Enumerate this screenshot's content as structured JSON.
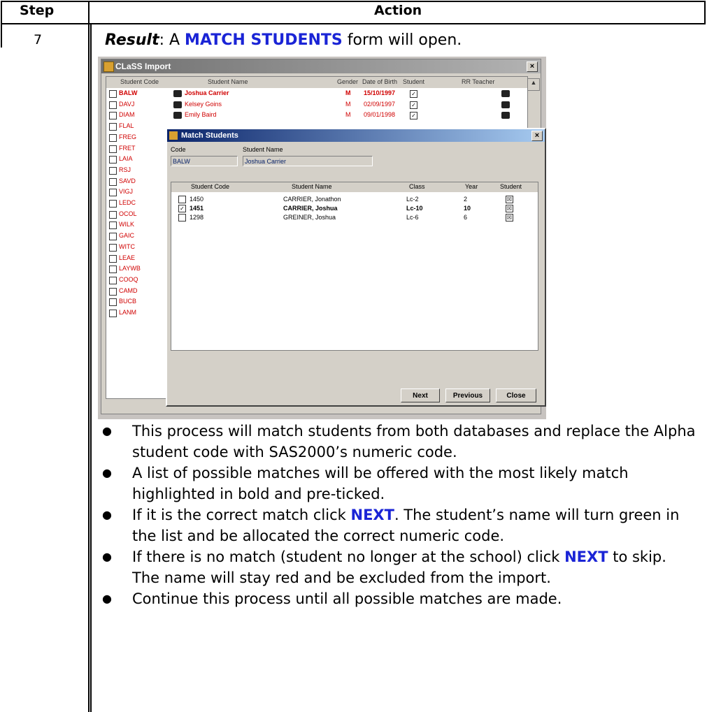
{
  "table": {
    "header_step": "Step",
    "header_action": "Action",
    "step_number": "7"
  },
  "result": {
    "prefix": "Result",
    "colon": ":  A ",
    "keyword": "MATCH STUDENTS",
    "suffix": " form will open."
  },
  "screenshot": {
    "main_window_title": "CLaSS Import",
    "columns": [
      "Student Code",
      "Student Name",
      "Gender",
      "Date of Birth",
      "Student",
      "RR Teacher"
    ],
    "rows": [
      {
        "code": "BALW",
        "name": "Joshua Carrier",
        "gender": "M",
        "dob": "15/10/1997",
        "bold": true
      },
      {
        "code": "DAVJ",
        "name": "Kelsey Goins",
        "gender": "M",
        "dob": "02/09/1997",
        "bold": false
      },
      {
        "code": "DIAM",
        "name": "Emily Baird",
        "gender": "M",
        "dob": "09/01/1998",
        "bold": false
      },
      {
        "code": "FLAL"
      },
      {
        "code": "FREG"
      },
      {
        "code": "FRET"
      },
      {
        "code": "LAIA"
      },
      {
        "code": "RSJ"
      },
      {
        "code": "SAVD"
      },
      {
        "code": "VIGJ"
      },
      {
        "code": "LEDC"
      },
      {
        "code": "OCOL"
      },
      {
        "code": "WILK"
      },
      {
        "code": "GAIC"
      },
      {
        "code": "WITC"
      },
      {
        "code": "LEAE"
      },
      {
        "code": "LAYWB"
      },
      {
        "code": "COOQ"
      },
      {
        "code": "CAMD"
      },
      {
        "code": "BUCB"
      },
      {
        "code": "LANM"
      }
    ],
    "dialog": {
      "title": "Match Students",
      "code_label": "Code",
      "name_label": "Student Name",
      "code_value": "BALW",
      "name_value": "Joshua Carrier",
      "columns": [
        "Student Code",
        "Student Name",
        "Class",
        "Year",
        "Student"
      ],
      "rows": [
        {
          "code": "1450",
          "name": "CARRIER, Jonathon",
          "class": "Lc-2",
          "year": "2",
          "checked": false,
          "bold": false
        },
        {
          "code": "1451",
          "name": "CARRIER, Joshua",
          "class": "Lc-10",
          "year": "10",
          "checked": true,
          "bold": true
        },
        {
          "code": "1298",
          "name": "GREINER, Joshua",
          "class": "Lc-6",
          "year": "6",
          "checked": false,
          "bold": false
        }
      ],
      "buttons": {
        "next": "Next",
        "previous": "Previous",
        "close": "Close"
      }
    }
  },
  "bullets": {
    "b1": "This process will match students from both databases and replace the Alpha student code with SAS2000’s numeric code.",
    "b2": "A list of possible matches will be offered with the most likely match highlighted in bold and pre-ticked.",
    "b3_pre": "If it is the correct match click ",
    "b3_kw": "NEXT",
    "b3_post": ".  The student’s name will turn green in the list and be allocated the correct numeric code.",
    "b4_pre": "If there is no match (student no longer at the school) click ",
    "b4_kw": "NEXT",
    "b4_post": " to skip.  The name will stay red and be excluded from the import.",
    "b5": "Continue this process until all possible matches are made."
  }
}
